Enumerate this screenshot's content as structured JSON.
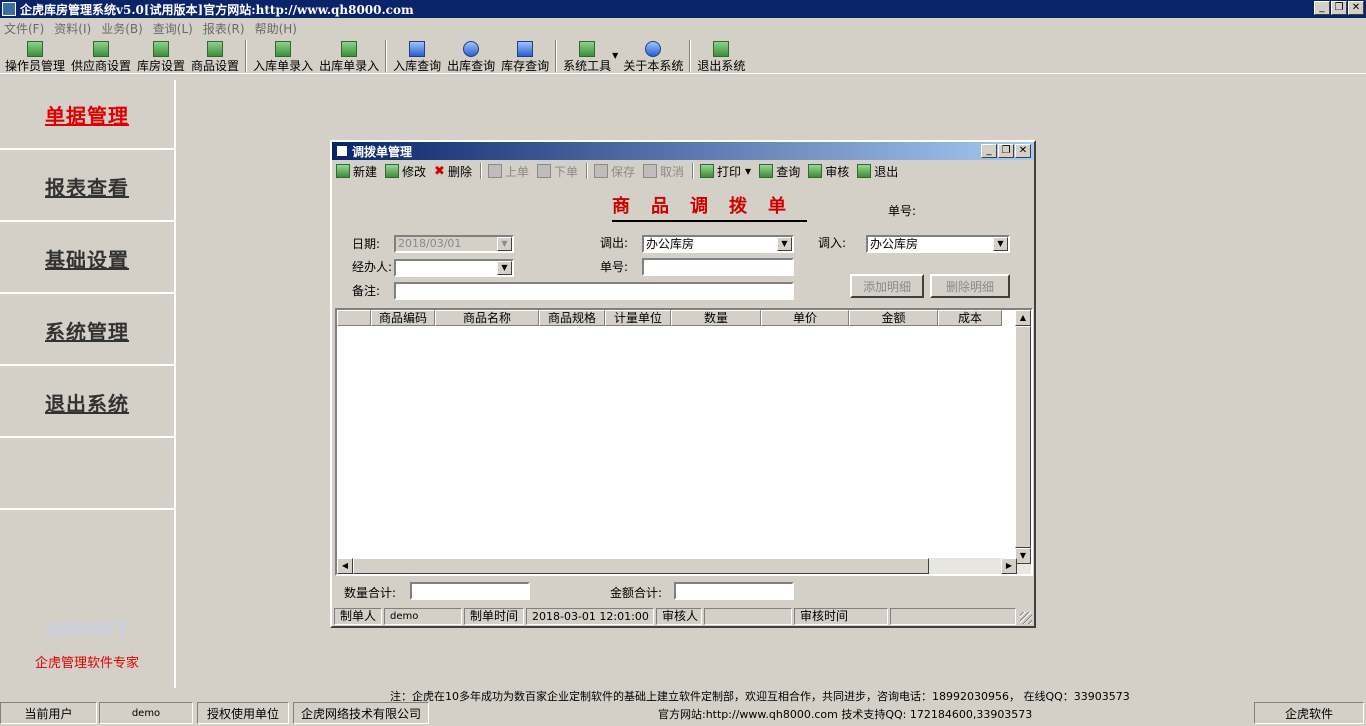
{
  "window": {
    "title": "企虎库房管理系统v5.0[试用版本]官方网站:http://www.qh8000.com",
    "min_glyph": "_",
    "max_glyph": "❐",
    "close_glyph": "✕"
  },
  "menu": [
    "文件(F)",
    "资料(I)",
    "业务(B)",
    "查询(L)",
    "报表(R)",
    "帮助(H)"
  ],
  "toolbar": {
    "items": [
      {
        "label": "操作员管理",
        "icon": "grid-icon"
      },
      {
        "label": "供应商设置",
        "icon": "grid-icon"
      },
      {
        "label": "库房设置",
        "icon": "grid-icon"
      },
      {
        "label": "商品设置",
        "icon": "grid-icon"
      },
      {
        "label": "入库单录入",
        "icon": "edit-icon"
      },
      {
        "label": "出库单录入",
        "icon": "edit-icon"
      },
      {
        "label": "入库查询",
        "icon": "search-doc-icon"
      },
      {
        "label": "出库查询",
        "icon": "search-icon"
      },
      {
        "label": "库存查询",
        "icon": "speaker-icon"
      },
      {
        "label": "系统工具",
        "icon": "tools-icon"
      },
      {
        "label": "关于本系统",
        "icon": "help-icon"
      },
      {
        "label": "退出系统",
        "icon": "exit-icon"
      }
    ],
    "caret": "▼"
  },
  "leftnav": {
    "items": [
      "单据管理",
      "报表查看",
      "基础设置",
      "系统管理",
      "退出系统"
    ],
    "active": "单据管理",
    "brand_en": "QHSOFT",
    "brand_cn": "企虎管理软件专家"
  },
  "dialog": {
    "title": "调拨单管理",
    "toolbar": {
      "new": "新建",
      "edit": "修改",
      "delete": "删除",
      "prev": "上单",
      "next": "下单",
      "save": "保存",
      "cancel": "取消",
      "print": "打印",
      "print_caret": "▼",
      "query": "查询",
      "audit": "审核",
      "exit": "退出",
      "delete_glyph": "✖"
    },
    "form_title": "商品调拨单",
    "doc_no_label": "单号:",
    "date_label": "日期:",
    "date_value": "2018/03/01",
    "out_label": "调出:",
    "out_value": "办公库房",
    "in_label": "调入:",
    "in_value": "办公库房",
    "handler_label": "经办人:",
    "handler_value": "",
    "no_label": "单号:",
    "no_value": "",
    "remark_label": "备注:",
    "remark_value": "",
    "add_detail": "添加明细",
    "delete_detail": "删除明细",
    "dropdown_glyph": "▼",
    "grid": {
      "columns": [
        "",
        "商品编码",
        "商品名称",
        "商品规格",
        "计量单位",
        "数量",
        "单价",
        "金额",
        "成本"
      ],
      "rows": []
    },
    "qty_total_label": "数量合计:",
    "qty_total_value": "",
    "amount_total_label": "金额合计:",
    "amount_total_value": "",
    "status": {
      "maker_label": "制单人",
      "maker_value": "demo",
      "make_time_label": "制单时间",
      "make_time_value": "2018-03-01 12:01:00",
      "auditor_label": "审核人",
      "auditor_value": "",
      "audit_time_label": "审核时间",
      "audit_time_value": ""
    }
  },
  "footnote": "注：企虎在10多年成功为数百家企业定制软件的基础上建立软件定制部，欢迎互相合作，共同进步，咨询电话：18992030956， 在线QQ：33903573",
  "statusbar": {
    "current_user_label": "当前用户",
    "current_user_value": "demo",
    "licensee_label": "授权使用单位",
    "licensee_value": "企虎网络技术有限公司",
    "website": "官方网站:http://www.qh8000.com 技术支持QQ: 172184600,33903573",
    "brand": "企虎软件"
  },
  "scroll_glyphs": {
    "up": "▲",
    "down": "▼",
    "left": "◀",
    "right": "▶"
  }
}
